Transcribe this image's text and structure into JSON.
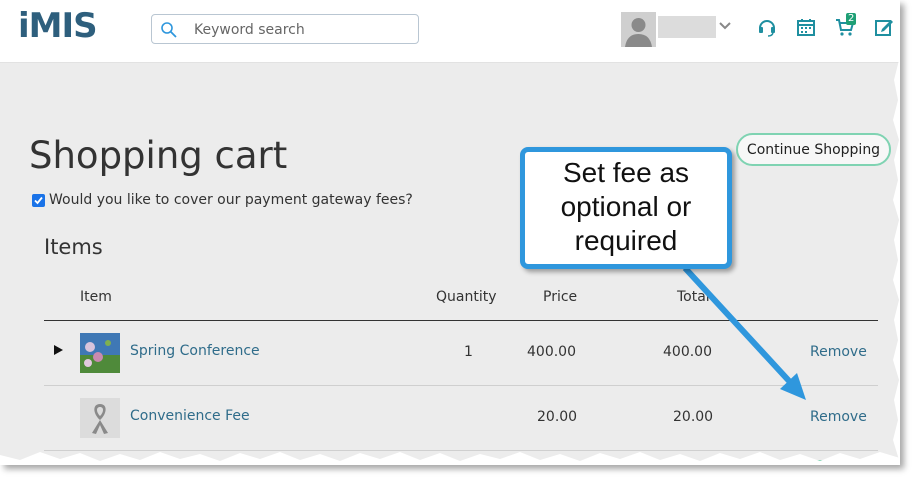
{
  "header": {
    "logo": "iMIS",
    "search_placeholder": "Keyword search",
    "cart_count": "2",
    "icons": [
      "headset-icon",
      "calendar-icon",
      "cart-icon",
      "edit-icon"
    ]
  },
  "page": {
    "title": "Shopping cart",
    "continue_label": "Continue Shopping",
    "fee_question": "Would you like to cover our payment gateway fees?",
    "fee_checked": true,
    "items_heading": "Items"
  },
  "table": {
    "headers": {
      "item": "Item",
      "quantity": "Quantity",
      "price": "Price",
      "total": "Total"
    },
    "rows": [
      {
        "name": "Spring Conference",
        "quantity": "1",
        "price": "400.00",
        "total": "400.00",
        "action": "Remove"
      },
      {
        "name": "Convenience Fee",
        "quantity": "",
        "price": "20.00",
        "total": "20.00",
        "action": "Remove"
      }
    ]
  },
  "callout": {
    "lines": [
      "Set fee as",
      "optional or",
      "required"
    ]
  },
  "colors": {
    "brand": "#2e5f7d",
    "link": "#2f6c8a",
    "accent_green": "#1e9f75",
    "callout_blue": "#2f97dd"
  }
}
